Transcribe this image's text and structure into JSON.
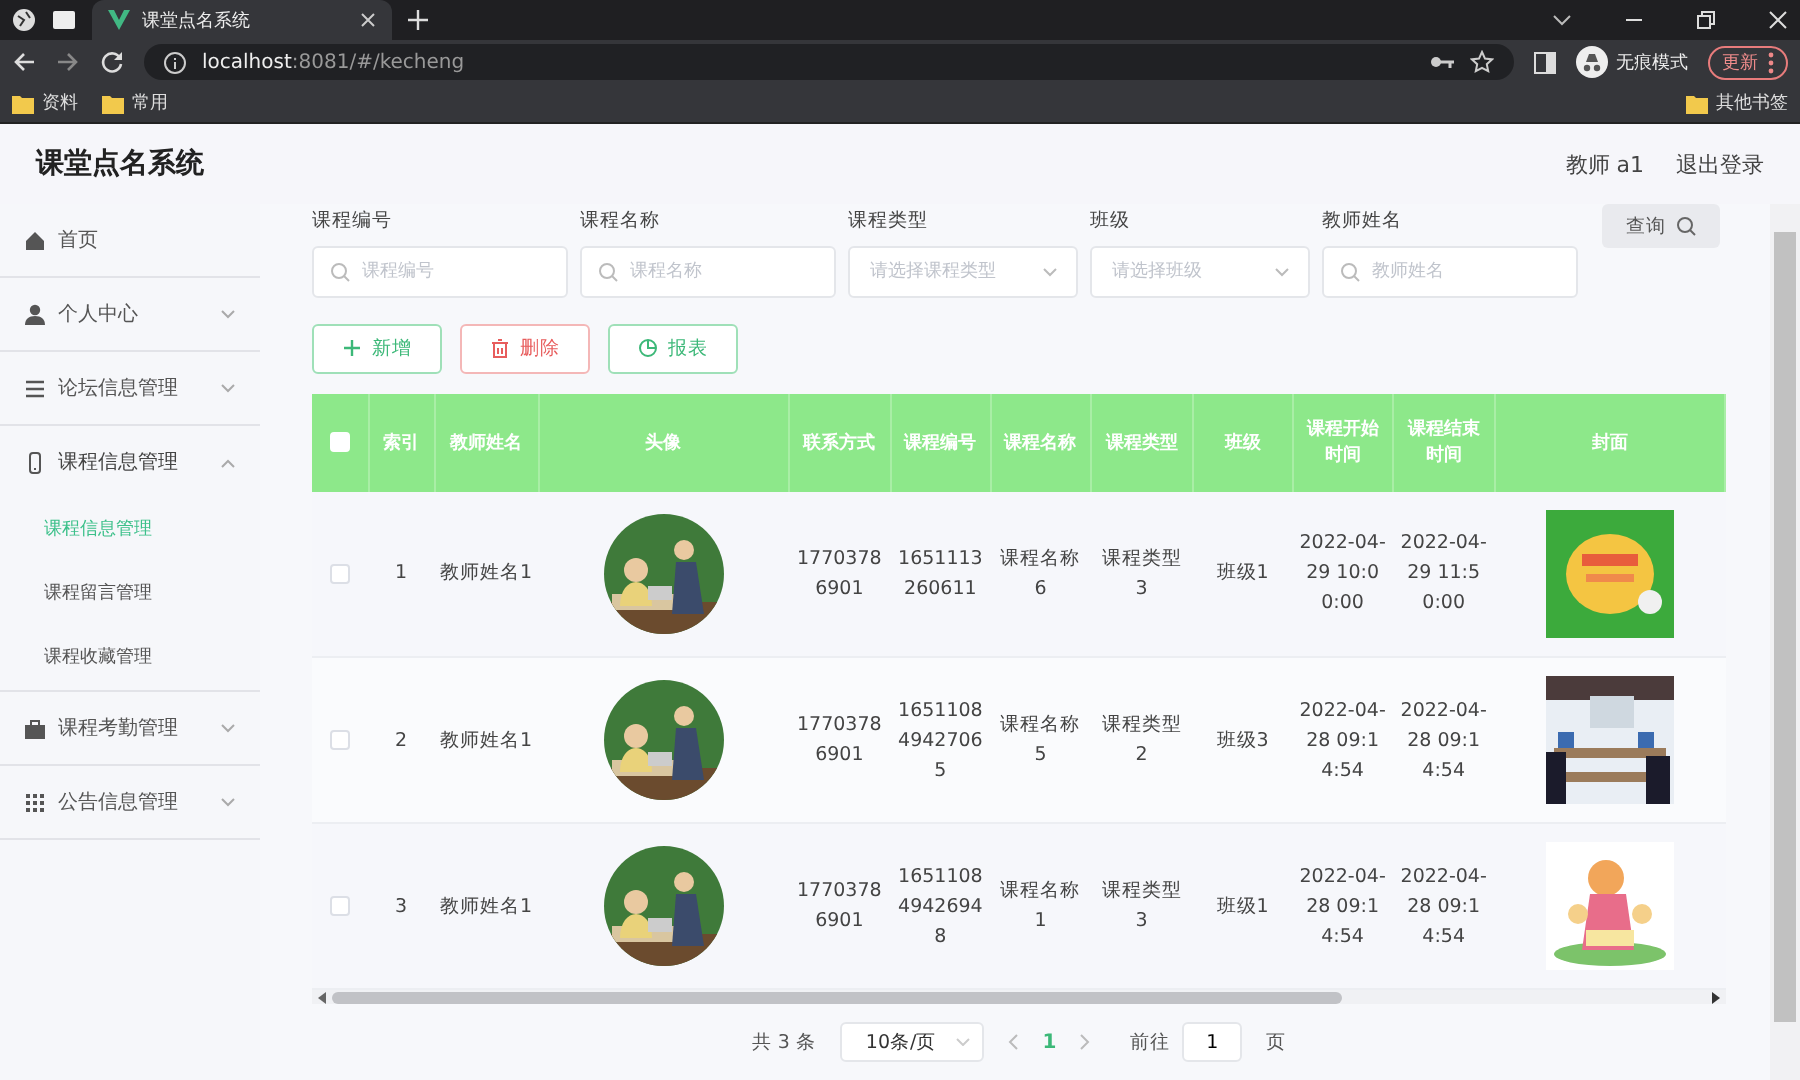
{
  "browser": {
    "tabs": [
      {
        "title": "课堂点名系统",
        "selected": true
      }
    ],
    "url_host": "localhost",
    "url_rest": ":8081/#/kecheng",
    "profile": "无痕模式",
    "update_button": "更新",
    "bookmarks": [
      "资料",
      "常用"
    ],
    "other_bookmarks": "其他书签"
  },
  "app": {
    "title": "课堂点名系统",
    "user": "教师 a1",
    "logout": "退出登录"
  },
  "sidebar": {
    "items": [
      {
        "label": "首页",
        "kind": "home"
      },
      {
        "label": "个人中心",
        "kind": "person",
        "expanded": false
      },
      {
        "label": "论坛信息管理",
        "kind": "lines",
        "expanded": false
      },
      {
        "label": "课程信息管理",
        "kind": "phone",
        "expanded": true,
        "children": [
          {
            "label": "课程信息管理",
            "selected": true
          },
          {
            "label": "课程留言管理",
            "selected": false
          },
          {
            "label": "课程收藏管理",
            "selected": false
          }
        ]
      },
      {
        "label": "课程考勤管理",
        "kind": "case",
        "expanded": false
      },
      {
        "label": "公告信息管理",
        "kind": "grid",
        "expanded": false
      }
    ]
  },
  "filters": [
    {
      "label": "课程编号",
      "kind": "search",
      "placeholder": "课程编号"
    },
    {
      "label": "课程名称",
      "kind": "search",
      "placeholder": "课程名称"
    },
    {
      "label": "课程类型",
      "kind": "select",
      "placeholder": "请选择课程类型"
    },
    {
      "label": "班级",
      "kind": "select",
      "placeholder": "请选择班级"
    },
    {
      "label": "教师姓名",
      "kind": "search",
      "placeholder": "教师姓名"
    }
  ],
  "query_button": "查询",
  "actions": [
    {
      "label": "新增",
      "kind": "add"
    },
    {
      "label": "删除",
      "kind": "delete"
    },
    {
      "label": "报表",
      "kind": "report"
    }
  ],
  "table": {
    "select_all": {
      "checked": false
    },
    "columns": [
      "索引",
      "教师姓名",
      "头像",
      "联系方式",
      "课程编号",
      "课程名称",
      "课程类型",
      "班级",
      "课程开始时间",
      "课程结束时间",
      "封面"
    ],
    "rows": [
      {
        "checked": false,
        "cells": [
          "1",
          "教师姓名1",
          "",
          "17703786901",
          "1651113260611",
          "课程名称6",
          "课程类型3",
          "班级1",
          "2022-04-29 10:00:00",
          "2022-04-29 11:50:00",
          ""
        ]
      },
      {
        "checked": false,
        "cells": [
          "2",
          "教师姓名1",
          "",
          "17703786901",
          "165110849427065",
          "课程名称5",
          "课程类型2",
          "班级3",
          "2022-04-28 09:14:54",
          "2022-04-28 09:14:54",
          ""
        ]
      },
      {
        "checked": false,
        "cells": [
          "3",
          "教师姓名1",
          "",
          "17703786901",
          "165110849426948",
          "课程名称1",
          "课程类型3",
          "班级1",
          "2022-04-28 09:14:54",
          "2022-04-28 09:14:54",
          ""
        ]
      }
    ]
  },
  "pagination": {
    "total": "共 3 条",
    "page_size": "10条/页",
    "pages": [
      {
        "label": "1",
        "selected": true
      }
    ],
    "goto": "前往",
    "goto_value": "1",
    "page_unit": "页"
  }
}
